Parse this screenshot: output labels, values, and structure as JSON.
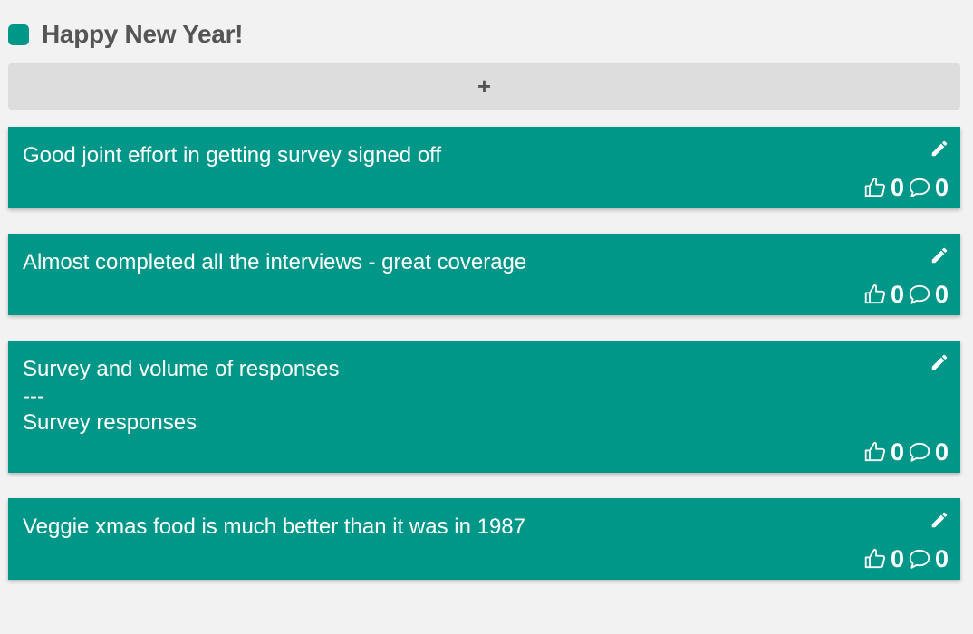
{
  "column": {
    "title": "Happy New Year!",
    "color": "#009688",
    "add_label": "+"
  },
  "cards": [
    {
      "text": "Good joint effort in getting survey signed off",
      "likes": "0",
      "comments": "0"
    },
    {
      "text": "Almost completed all the interviews - great coverage",
      "likes": "0",
      "comments": "0"
    },
    {
      "text": "Survey and volume of responses\n---\nSurvey responses",
      "likes": "0",
      "comments": "0"
    },
    {
      "text": "Veggie xmas food is much better than it was in 1987",
      "likes": "0",
      "comments": "0"
    }
  ],
  "icons": {
    "edit": "pencil-icon",
    "like": "thumbs-up-icon",
    "comment": "comment-icon"
  }
}
